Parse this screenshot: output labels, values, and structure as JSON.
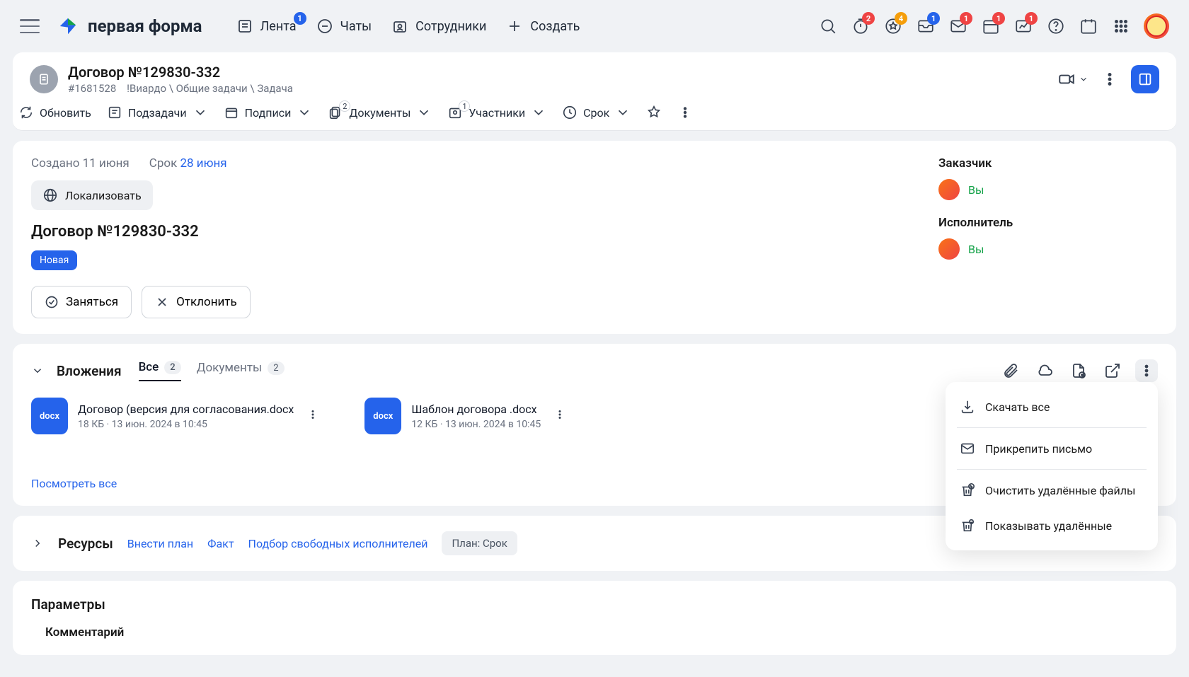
{
  "nav": {
    "logo_text": "первая форма",
    "items": [
      {
        "label": "Лента",
        "badge": "1"
      },
      {
        "label": "Чаты"
      },
      {
        "label": "Сотрудники"
      },
      {
        "label": "Создать"
      }
    ],
    "badges": {
      "timer": "2",
      "star": "4",
      "inbox": "1",
      "envelope": "1",
      "cal": "1",
      "chart": "1"
    }
  },
  "header": {
    "title": "Договор №129830-332",
    "id": "#1681528",
    "breadcrumb": "!Виардо \\ Общие задачи \\ Задача"
  },
  "toolbar": {
    "refresh": "Обновить",
    "subtasks": "Подзадачи",
    "signatures": "Подписи",
    "documents": "Документы",
    "documents_badge": "2",
    "participants": "Участники",
    "participants_badge": "1",
    "deadline": "Срок"
  },
  "task": {
    "created_label": "Создано 11 июня",
    "deadline_label": "Срок",
    "deadline_value": "28 июня",
    "localize": "Локализовать",
    "title": "Договор №129830-332",
    "status": "Новая",
    "accept": "Заняться",
    "reject": "Отклонить",
    "customer_label": "Заказчик",
    "executor_label": "Исполнитель",
    "you": "Вы"
  },
  "attachments": {
    "title": "Вложения",
    "tab_all": "Все",
    "tab_all_count": "2",
    "tab_docs": "Документы",
    "tab_docs_count": "2",
    "files": [
      {
        "ext": "docx",
        "name": "Договор (версия для согласования.docx",
        "meta": "18 КБ · 13 июн. 2024 в 10:45"
      },
      {
        "ext": "docx",
        "name": "Шаблон договора .docx",
        "meta": "12 КБ · 13 июн. 2024 в 10:45"
      }
    ],
    "view_all": "Посмотреть все"
  },
  "dropdown": {
    "download_all": "Скачать все",
    "attach_mail": "Прикрепить письмо",
    "clear_deleted": "Очистить удалённые файлы",
    "show_deleted": "Показывать удалённые"
  },
  "resources": {
    "title": "Ресурсы",
    "plan": "Внести план",
    "fact": "Факт",
    "pick": "Подбор свободных исполнителей",
    "chip": "План: Срок"
  },
  "params": {
    "title": "Параметры",
    "comment": "Комментарий"
  }
}
